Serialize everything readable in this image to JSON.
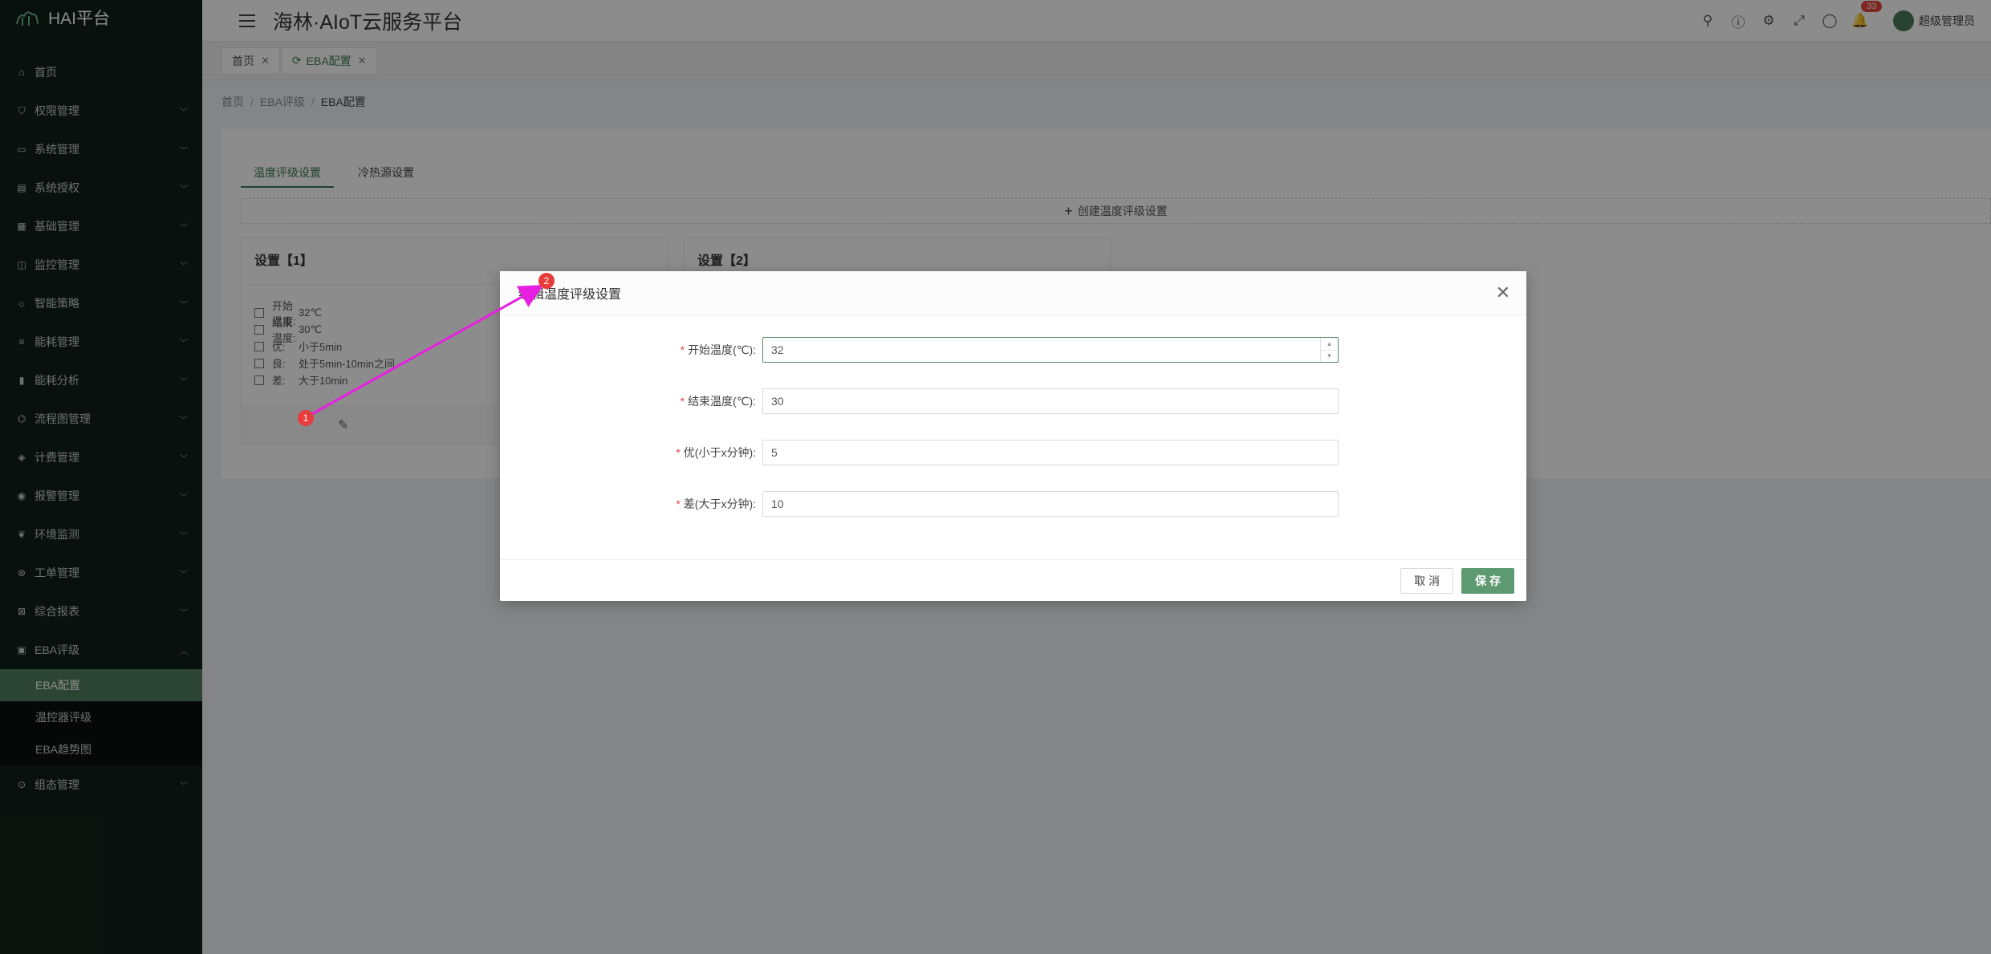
{
  "app": {
    "logo_text": "HAI平台",
    "title": "海林·AIoT云服务平台"
  },
  "header": {
    "notification_count": "33",
    "user_name": "超级管理员"
  },
  "sidebar": {
    "items": [
      {
        "label": "首页",
        "icon": "home-icon"
      },
      {
        "label": "权限管理",
        "icon": "shield-icon"
      },
      {
        "label": "系统管理",
        "icon": "monitor-icon"
      },
      {
        "label": "系统授权",
        "icon": "license-icon"
      },
      {
        "label": "基础管理",
        "icon": "grid-icon"
      },
      {
        "label": "监控管理",
        "icon": "camera-icon"
      },
      {
        "label": "智能策略",
        "icon": "bulb-icon"
      },
      {
        "label": "能耗管理",
        "icon": "sliders-icon"
      },
      {
        "label": "能耗分析",
        "icon": "bar-chart-icon"
      },
      {
        "label": "流程图管理",
        "icon": "flow-icon"
      },
      {
        "label": "计费管理",
        "icon": "billing-icon"
      },
      {
        "label": "报警管理",
        "icon": "alarm-icon"
      },
      {
        "label": "环境监测",
        "icon": "leaf-icon"
      },
      {
        "label": "工单管理",
        "icon": "ticket-icon"
      },
      {
        "label": "综合报表",
        "icon": "report-icon"
      },
      {
        "label": "EBA评级",
        "icon": "eba-icon"
      }
    ],
    "eba_sub": [
      {
        "label": "EBA配置",
        "active": true
      },
      {
        "label": "温控器评级",
        "active": false
      },
      {
        "label": "EBA趋势图",
        "active": false
      }
    ],
    "last_item": {
      "label": "组态管理",
      "icon": "config-icon"
    }
  },
  "tabs": [
    {
      "label": "首页"
    },
    {
      "label": "EBA配置"
    }
  ],
  "breadcrumb": [
    "首页",
    "EBA评级",
    "EBA配置"
  ],
  "main": {
    "inner_tabs": [
      "温度评级设置",
      "冷热源设置"
    ],
    "create_label": "创建温度评级设置",
    "card1": {
      "title": "设置【1】",
      "rows": [
        {
          "label": "开始温度:",
          "value": "32℃"
        },
        {
          "label": "结束温度:",
          "value": "30℃"
        },
        {
          "label": "优:",
          "value": "小于5min"
        },
        {
          "label": "良:",
          "value": "处于5min-10min之间"
        },
        {
          "label": "差:",
          "value": "大于10min"
        }
      ]
    },
    "card2": {
      "title": "设置【2】"
    }
  },
  "dialog": {
    "title": "编辑温度评级设置",
    "fields": [
      {
        "label": "开始温度(℃):",
        "value": "32"
      },
      {
        "label": "结束温度(℃):",
        "value": "30"
      },
      {
        "label": "优(小于x分钟):",
        "value": "5"
      },
      {
        "label": "差(大于x分钟):",
        "value": "10"
      }
    ],
    "cancel_label": "取 消",
    "save_label": "保 存"
  },
  "annotations": {
    "marker1": "1",
    "marker2": "2",
    "arrow_color": "#e81ee0"
  },
  "colors": {
    "accent": "#3d7a55",
    "sidebar_bg": "#12201a",
    "active_menu": "#4f7c5d",
    "badge": "#e6463d"
  }
}
